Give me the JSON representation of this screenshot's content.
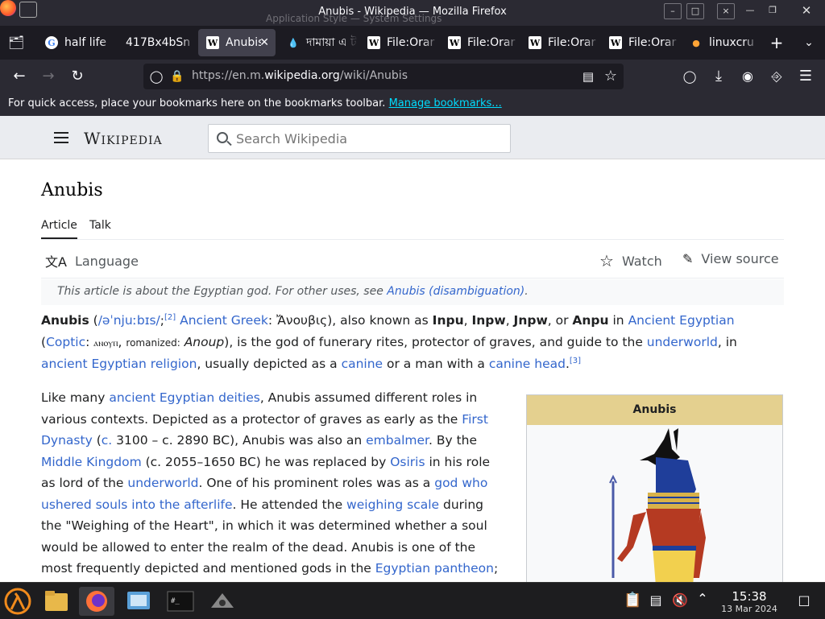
{
  "window": {
    "title": "Anubis - Wikipedia — Mozilla Firefox",
    "background_title": "Application Style — System Settings"
  },
  "tabs": [
    {
      "label": "half life",
      "favicon": "google-icon",
      "active": false
    },
    {
      "label": "417Bx4bSn",
      "favicon": "none",
      "active": false
    },
    {
      "label": "Anubis",
      "favicon": "wikipedia-icon",
      "active": true
    },
    {
      "label": "দামায়া এ ট",
      "favicon": "flame-icon",
      "active": false
    },
    {
      "label": "File:Orar",
      "favicon": "wikipedia-icon",
      "active": false
    },
    {
      "label": "File:Orar",
      "favicon": "wikipedia-icon",
      "active": false
    },
    {
      "label": "File:Orar",
      "favicon": "wikipedia-icon",
      "active": false
    },
    {
      "label": "File:Orar",
      "favicon": "wikipedia-icon",
      "active": false
    },
    {
      "label": "linuxcru",
      "favicon": "bulb-icon",
      "active": false
    }
  ],
  "navbar": {
    "url_prefix": "https://en.m.",
    "url_domain": "wikipedia.org",
    "url_path": "/wiki/Anubis"
  },
  "bookmarks_bar": {
    "message": "For quick access, place your bookmarks here on the bookmarks toolbar.",
    "link": "Manage bookmarks..."
  },
  "wiki": {
    "wordmark": "Wikipedia",
    "search_placeholder": "Search Wikipedia",
    "title": "Anubis",
    "tab_article": "Article",
    "tab_talk": "Talk",
    "language": "Language",
    "watch": "Watch",
    "view_source": "View source",
    "hatnote_text": "This article is about the Egyptian god. For other uses, see ",
    "hatnote_link": "Anubis (disambiguation)",
    "hatnote_end": ".",
    "infobox_title": "Anubis"
  },
  "taskbar": {
    "time": "15:38",
    "date": "13 Mar 2024"
  },
  "colors": {
    "link": "#3366cc",
    "infobox_header": "#e4d08f",
    "firefox_chrome": "#2b2a33"
  }
}
